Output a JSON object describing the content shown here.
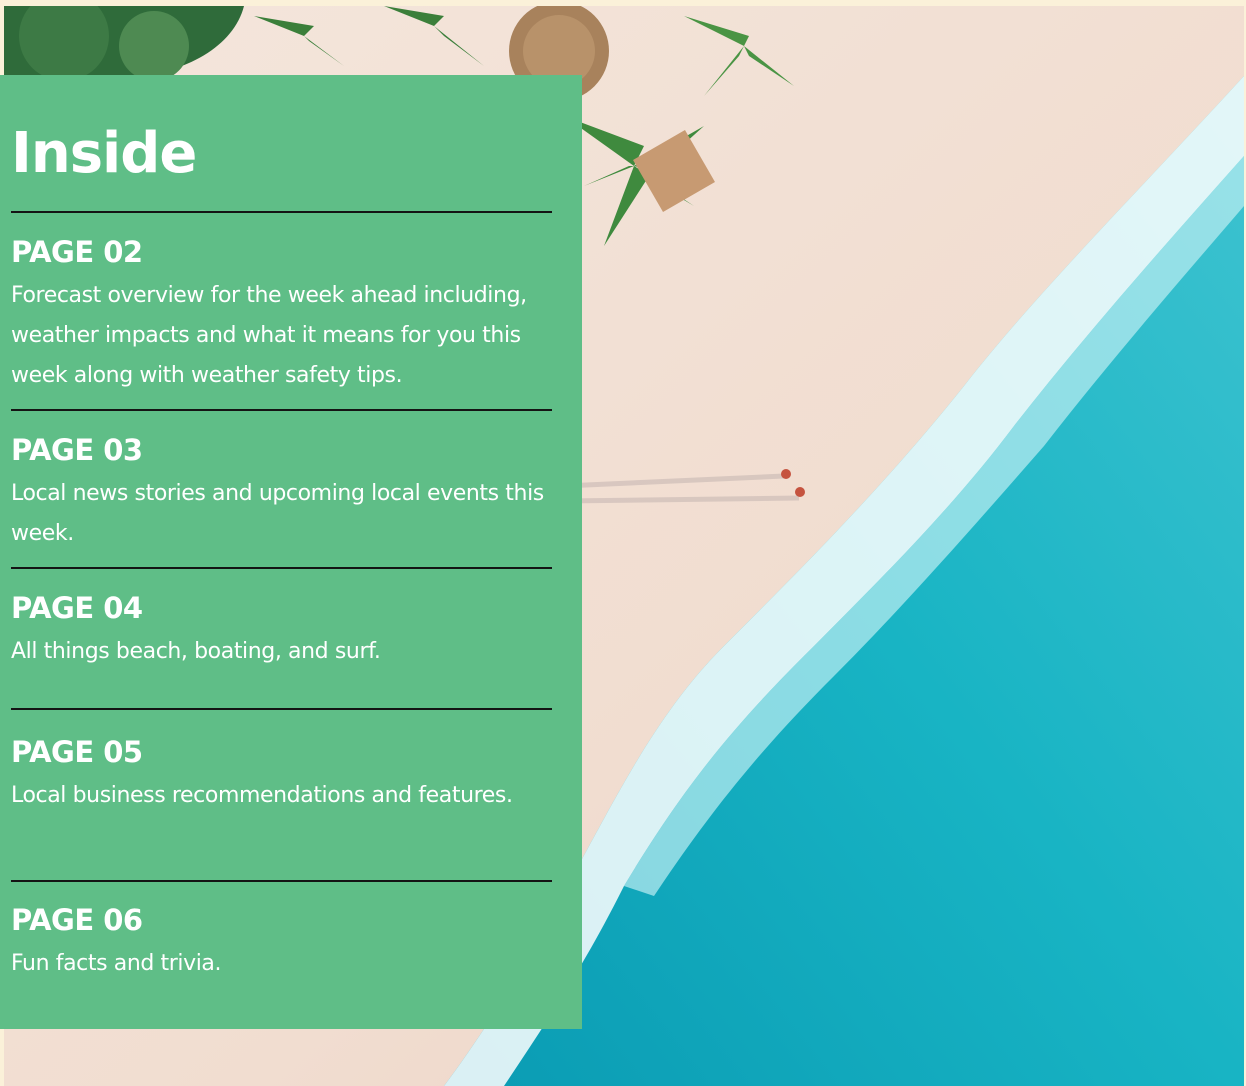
{
  "panel": {
    "title": "Inside",
    "sections": [
      {
        "page": "PAGE 02",
        "description": "Forecast overview for the week ahead including, weather impacts and what it means for you this week along with weather safety tips."
      },
      {
        "page": "PAGE 03",
        "description": "Local news stories and upcoming local events this week."
      },
      {
        "page": "PAGE 04",
        "description": "All things beach, boating, and surf."
      },
      {
        "page": "PAGE 05",
        "description": "Local business recommendations and features."
      },
      {
        "page": "PAGE 06",
        "description": "Fun facts and trivia."
      }
    ]
  },
  "colors": {
    "panel_green": "#5fbe87",
    "text": "#ffffff",
    "rule": "#141414",
    "page_background": "#fbf1d9",
    "sand": "#f3e1d4",
    "sea": "#16b6c6"
  }
}
